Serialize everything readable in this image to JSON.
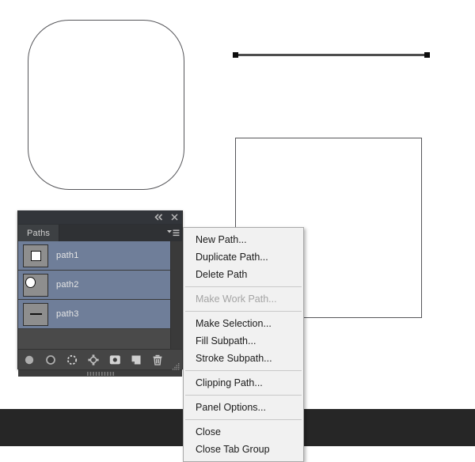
{
  "canvas": {
    "shapes": [
      {
        "name": "rounded-rectangle-path",
        "type": "rounded-rect"
      },
      {
        "name": "line-path",
        "type": "line"
      },
      {
        "name": "rectangle-path",
        "type": "rect"
      }
    ]
  },
  "panel": {
    "tab_label": "Paths",
    "titlebar": {
      "collapse_icon": "double-chevron-left-icon",
      "close_icon": "close-icon"
    },
    "menu_icon": "panel-menu-icon",
    "rows": [
      {
        "label": "path1",
        "thumb": "rounded-square-thumbnail",
        "selected": true
      },
      {
        "label": "path2",
        "thumb": "circle-thumbnail",
        "selected": true
      },
      {
        "label": "path3",
        "thumb": "line-thumbnail",
        "selected": true
      }
    ],
    "toolbar": [
      {
        "name": "fill-path-with-foreground-color-button",
        "icon": "filled-circle-icon"
      },
      {
        "name": "stroke-path-with-brush-button",
        "icon": "circle-outline-icon"
      },
      {
        "name": "load-path-as-selection-button",
        "icon": "dashed-selection-icon"
      },
      {
        "name": "make-work-path-from-selection-button",
        "icon": "anchor-points-icon"
      },
      {
        "name": "add-layer-mask-button",
        "icon": "mask-square-icon"
      },
      {
        "name": "create-new-path-button",
        "icon": "new-page-icon"
      },
      {
        "name": "delete-current-path-button",
        "icon": "trash-icon"
      }
    ],
    "resize_grip_icon": "resize-grip-icon",
    "scrollbar": "vertical-scrollbar"
  },
  "context_menu": {
    "items": [
      {
        "label": "New Path...",
        "disabled": false
      },
      {
        "label": "Duplicate Path...",
        "disabled": false
      },
      {
        "label": "Delete Path",
        "disabled": false
      },
      {
        "separator": true
      },
      {
        "label": "Make Work Path...",
        "disabled": true
      },
      {
        "separator": true
      },
      {
        "label": "Make Selection...",
        "disabled": false
      },
      {
        "label": "Fill Subpath...",
        "disabled": false
      },
      {
        "label": "Stroke Subpath...",
        "disabled": false
      },
      {
        "separator": true
      },
      {
        "label": "Clipping Path...",
        "disabled": false
      },
      {
        "separator": true
      },
      {
        "label": "Panel Options...",
        "disabled": false
      },
      {
        "separator": true
      },
      {
        "label": "Close",
        "disabled": false
      },
      {
        "label": "Close Tab Group",
        "disabled": false
      }
    ]
  },
  "colors": {
    "panel_bg": "#3d3d3d",
    "row_selected": "#6f7e99",
    "list_bg": "#4a4a4a",
    "menu_bg": "#f1f1f1",
    "bottom_bar": "#262626",
    "path_stroke": "#56565a"
  }
}
